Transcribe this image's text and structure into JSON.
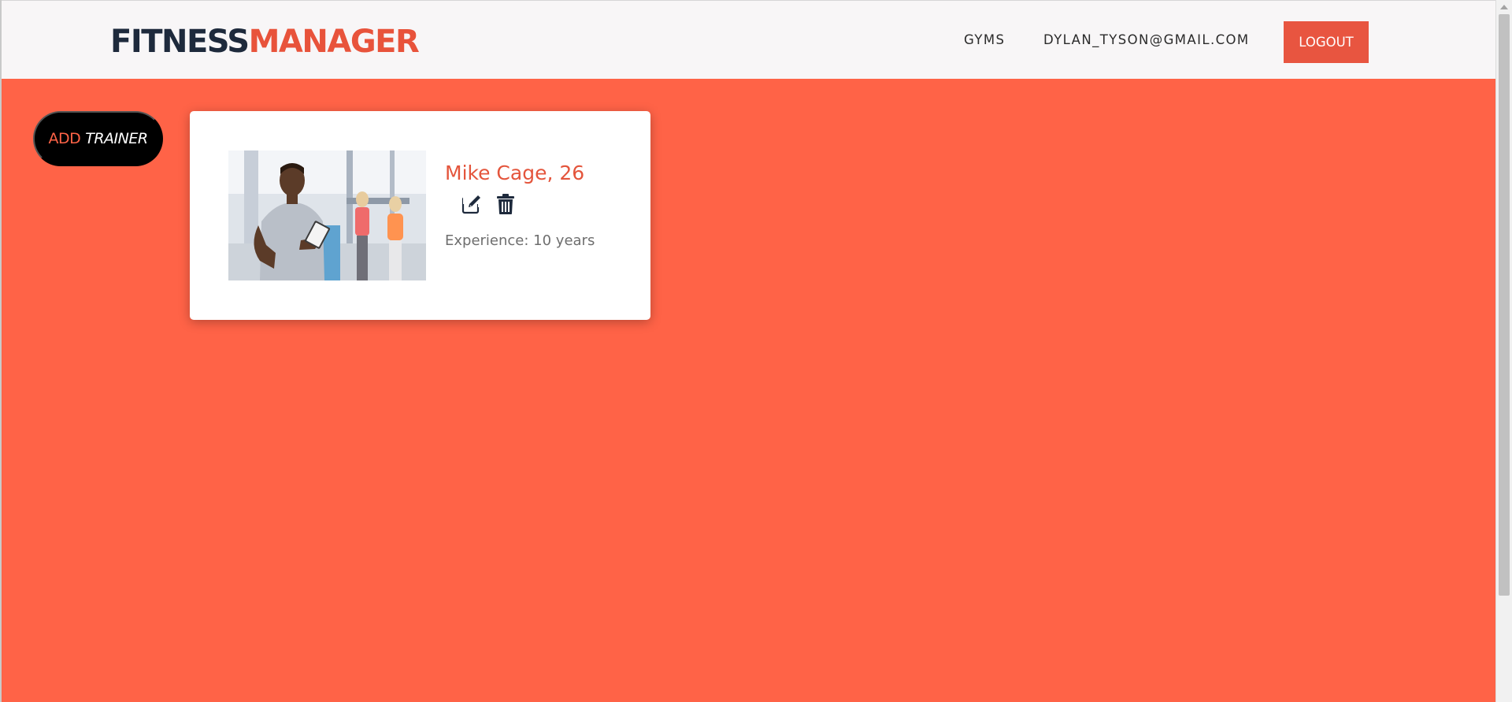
{
  "brand": {
    "part1": "FITNESS",
    "part2": "MANAGER"
  },
  "nav": {
    "gyms": "GYMS",
    "user_email": "DYLAN_TYSON@GMAIL.COM",
    "logout": "LOGOUT"
  },
  "add_trainer": {
    "word1": "ADD",
    "word2": "TRAINER"
  },
  "trainers": [
    {
      "name": "Mike Cage, 26",
      "experience": "Experience: 10 years",
      "photo_icon": "trainer-photo"
    }
  ],
  "icons": {
    "edit": "edit-icon",
    "delete": "trash-icon"
  },
  "colors": {
    "background": "#ff6347",
    "accent": "#e85540",
    "brand_dark": "#1e2a3c",
    "header_bg": "#f8f6f7",
    "add_button_bg": "#000000",
    "name_text": "#e4553c",
    "muted_text": "#6e6e6e"
  }
}
